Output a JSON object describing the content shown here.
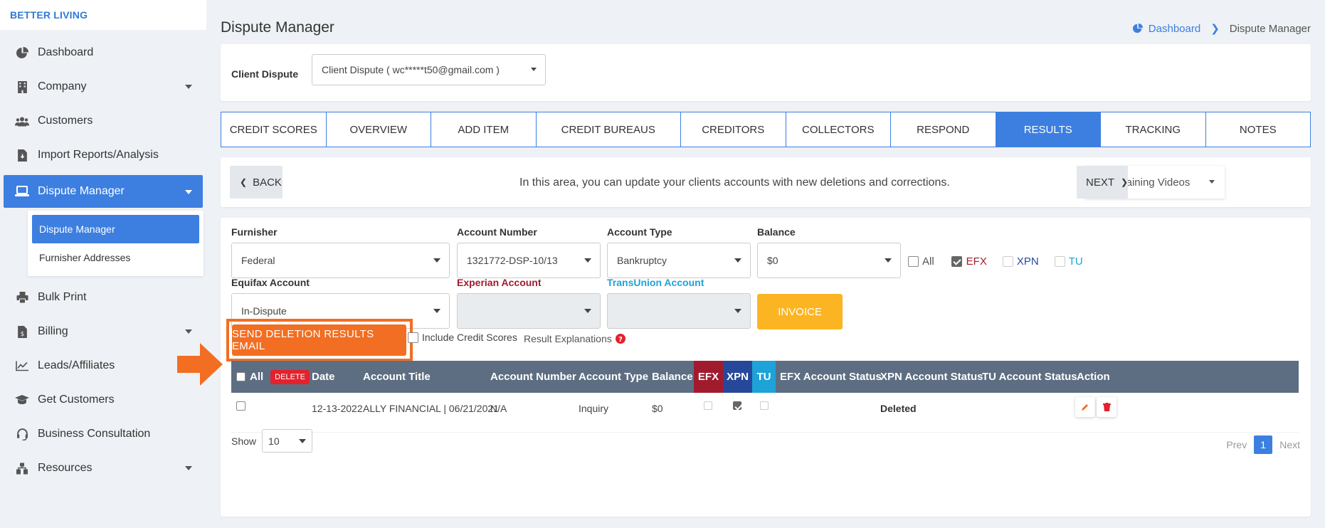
{
  "brand": "BETTER LIVING",
  "sidebar": {
    "items": [
      {
        "label": "Dashboard",
        "icon": "pie-chart-icon"
      },
      {
        "label": "Company",
        "icon": "building-icon"
      },
      {
        "label": "Customers",
        "icon": "users-icon"
      },
      {
        "label": "Import Reports/Analysis",
        "icon": "file-import-icon"
      },
      {
        "label": "Dispute Manager",
        "icon": "laptop-icon"
      },
      {
        "label": "Bulk Print",
        "icon": "printer-icon"
      },
      {
        "label": "Billing",
        "icon": "wallet-icon"
      },
      {
        "label": "Leads/Affiliates",
        "icon": "line-chart-icon"
      },
      {
        "label": "Get Customers",
        "icon": "graduation-cap-icon"
      },
      {
        "label": "Business Consultation",
        "icon": "headset-icon"
      },
      {
        "label": "Resources",
        "icon": "sitemap-icon"
      }
    ],
    "submenu": [
      "Dispute Manager",
      "Furnisher Addresses"
    ]
  },
  "page": {
    "title": "Dispute Manager",
    "breadcrumb": {
      "home": "Dashboard",
      "current": "Dispute Manager"
    }
  },
  "client": {
    "label": "Client Dispute",
    "value": "Client Dispute ( wc*****t50@gmail.com )"
  },
  "tabs": [
    "CREDIT SCORES",
    "OVERVIEW",
    "ADD ITEM",
    "CREDIT BUREAUS",
    "CREDITORS",
    "COLLECTORS",
    "RESPOND",
    "RESULTS",
    "TRACKING",
    "NOTES"
  ],
  "active_tab": "RESULTS",
  "navbar": {
    "back": "BACK",
    "info": "In this area, you can update your clients accounts with new deletions and corrections.",
    "training": "Training Videos",
    "next": "NEXT"
  },
  "filters": {
    "furnisher": {
      "label": "Furnisher",
      "value": "Federal"
    },
    "account_number": {
      "label": "Account Number",
      "value": "1321772-DSP-10/13"
    },
    "account_type": {
      "label": "Account Type",
      "value": "Bankruptcy"
    },
    "balance": {
      "label": "Balance",
      "value": "$0"
    },
    "bureaus": {
      "all": "All",
      "efx": "EFX",
      "xpn": "XPN",
      "tu": "TU"
    },
    "equifax": {
      "label": "Equifax Account",
      "value": "In-Dispute"
    },
    "experian": {
      "label": "Experian Account",
      "value": ""
    },
    "transunion": {
      "label": "TransUnion Account",
      "value": ""
    },
    "invoice": "INVOICE"
  },
  "actions": {
    "send_email": "SEND DELETION RESULTS EMAIL",
    "include_scores": "Include Credit Scores",
    "explanations": "Result Explanations"
  },
  "table": {
    "headers": {
      "all": "All",
      "delete": "DELETE",
      "date": "Date",
      "title": "Account Title",
      "number": "Account Number",
      "type": "Account Type",
      "balance": "Balance",
      "efx": "EFX",
      "xpn": "XPN",
      "tu": "TU",
      "efx_status": "EFX Account Status",
      "xpn_status": "XPN Account Status",
      "tu_status": "TU Account Status",
      "action": "Action"
    },
    "rows": [
      {
        "date": "12-13-2022",
        "title": "ALLY FINANCIAL | 06/21/2021",
        "number": "N/A",
        "type": "Inquiry",
        "balance": "$0",
        "efx_status": "",
        "xpn_status": "Deleted",
        "tu_status": ""
      }
    ]
  },
  "pagination": {
    "show_label": "Show",
    "page_size": "10",
    "prev": "Prev",
    "page": "1",
    "next": "Next"
  },
  "colors": {
    "primary": "#3d7fe0",
    "orange": "#f26e22",
    "invoice": "#fbb523",
    "efx": "#a11b2e",
    "xpn": "#27489a",
    "tu": "#1da3d8"
  }
}
